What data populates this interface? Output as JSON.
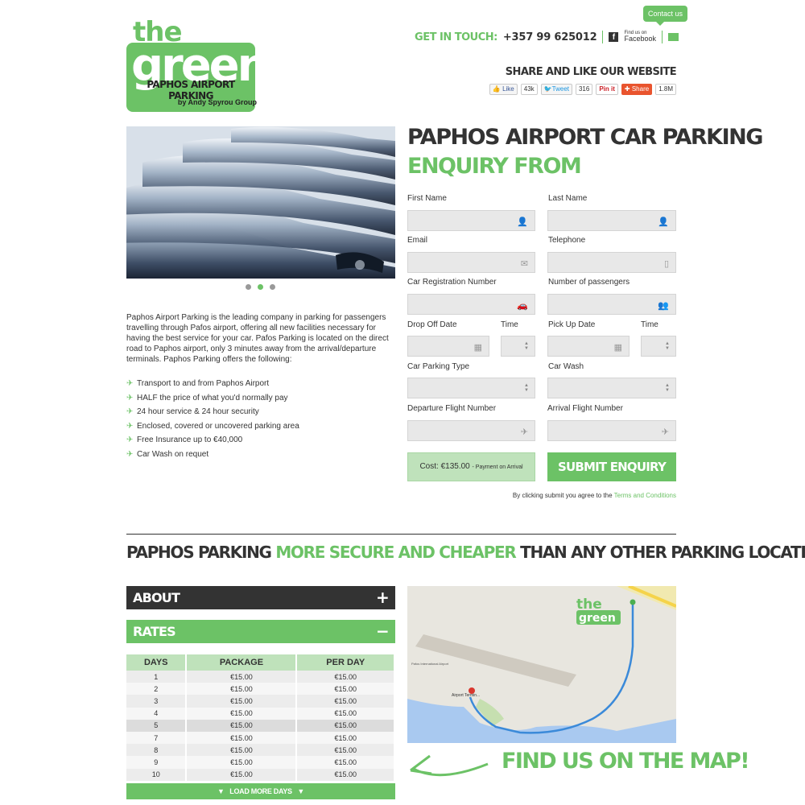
{
  "logo": {
    "the": "the",
    "green": "green",
    "subtitle": "PAPHOS AIRPORT PARKING",
    "by": "by Andy Spyrou Group"
  },
  "contact": {
    "bubble": "Contact us",
    "get_in_touch": "GET IN TOUCH:",
    "phone": "+357 99 625012",
    "fb_small": "Find us on",
    "fb_big": "Facebook"
  },
  "share": {
    "title": "SHARE AND LIKE OUR WEBSITE",
    "like": "Like",
    "like_count": "43k",
    "tweet": "Tweet",
    "tweet_count": "316",
    "pin": "Pin it",
    "gshare": "Share",
    "gshare_count": "1.8M"
  },
  "intro": "Paphos Airport Parking is the leading company in parking for passengers travelling through Pafos airport, offering all new facilities necessary for having the best service for your car. Pafos Parking is located on the direct road to Paphos airport, only 3 minutes away from the arrival/departure terminals. Paphos Parking offers the following:",
  "features": [
    "Transport to and from Paphos Airport",
    "HALF the price of what you'd normally pay",
    "24 hour service & 24 hour security",
    "Enclosed, covered or uncovered parking area",
    "Free Insurance up to €40,000",
    "Car Wash on requet"
  ],
  "form": {
    "title1": "PAPHOS AIRPORT CAR PARKING",
    "title2": "ENQUIRY FROM",
    "first_name": "First Name",
    "last_name": "Last Name",
    "email": "Email",
    "telephone": "Telephone",
    "car_reg": "Car Registration Number",
    "passengers": "Number of passengers",
    "drop_off": "Drop Off Date",
    "time": "Time",
    "pick_up": "Pick Up Date",
    "parking_type": "Car Parking Type",
    "car_wash": "Car Wash",
    "departure": "Departure Flight Number",
    "arrival": "Arrival Flight Number",
    "cost": "Cost: €135.00",
    "cost_note": "- Payment on Arrival",
    "submit": "SUBMIT ENQUIRY",
    "terms": "By clicking submit you agree to the",
    "terms_link": "Terms and Conditions"
  },
  "tagline": {
    "a": "PAPHOS PARKING ",
    "b": "MORE SECURE AND CHEAPER",
    "c": " THAN ANY OTHER PARKING LOCATION"
  },
  "accordion": {
    "about": "ABOUT",
    "rates": "RATES",
    "plus": "+",
    "minus": "−"
  },
  "rates": {
    "headers": [
      "DAYS",
      "PACKAGE",
      "PER DAY"
    ],
    "rows": [
      [
        "1",
        "€15.00",
        "€15.00"
      ],
      [
        "2",
        "€15.00",
        "€15.00"
      ],
      [
        "3",
        "€15.00",
        "€15.00"
      ],
      [
        "4",
        "€15.00",
        "€15.00"
      ],
      [
        "5",
        "€15.00",
        "€15.00"
      ],
      [
        "7",
        "€15.00",
        "€15.00"
      ],
      [
        "8",
        "€15.00",
        "€15.00"
      ],
      [
        "9",
        "€15.00",
        "€15.00"
      ],
      [
        "10",
        "€15.00",
        "€15.00"
      ]
    ],
    "load_more": "LOAD MORE DAYS"
  },
  "map": {
    "label_airport": "Airport Termin...",
    "label_intl": "Pafos International Airport",
    "find_us": "FIND US ON THE MAP!"
  },
  "colors": {
    "accent": "#6cc266",
    "dark": "#333333",
    "light_green": "#bfe2bb"
  }
}
